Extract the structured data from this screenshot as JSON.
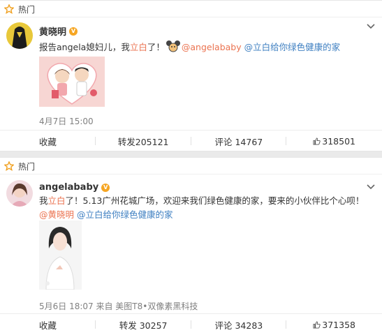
{
  "section_label": "热门",
  "posts": [
    {
      "author": "黄晓明",
      "verified": "V",
      "text_before": "报告angela媳妇儿，我",
      "text_red": "立白",
      "text_after": "了！",
      "mention": "@angelababy",
      "topic": "@立白给你绿色健康的家",
      "time": "4月7日 15:00",
      "actions": {
        "favorite": "收藏",
        "repost": "转发205121",
        "comment": "评论 14767",
        "like": "318501"
      }
    },
    {
      "author": "angelababy",
      "verified": "V",
      "text_start": "我",
      "text_red": "立白",
      "text_middle": "了！5.13广州花城广场，欢迎来我们绿色健康的家，要来的小伙伴比个心呗！",
      "mention": "@黄晓明",
      "topic": "@立白给你绿色健康的家",
      "time": "5月6日 18:07 来自 美图T8•双像素黑科技",
      "actions": {
        "favorite": "收藏",
        "repost": "转发 30257",
        "comment": "评论 34283",
        "like": "371358"
      }
    }
  ],
  "icons": {
    "hot": "star-icon",
    "menu": "chevron-down-icon",
    "like": "thumb-up-icon",
    "emoji": "mickey-emoji-icon"
  },
  "colors": {
    "accent": "#eb7350",
    "link": "#3e7fc1",
    "badge": "#f6a623"
  }
}
